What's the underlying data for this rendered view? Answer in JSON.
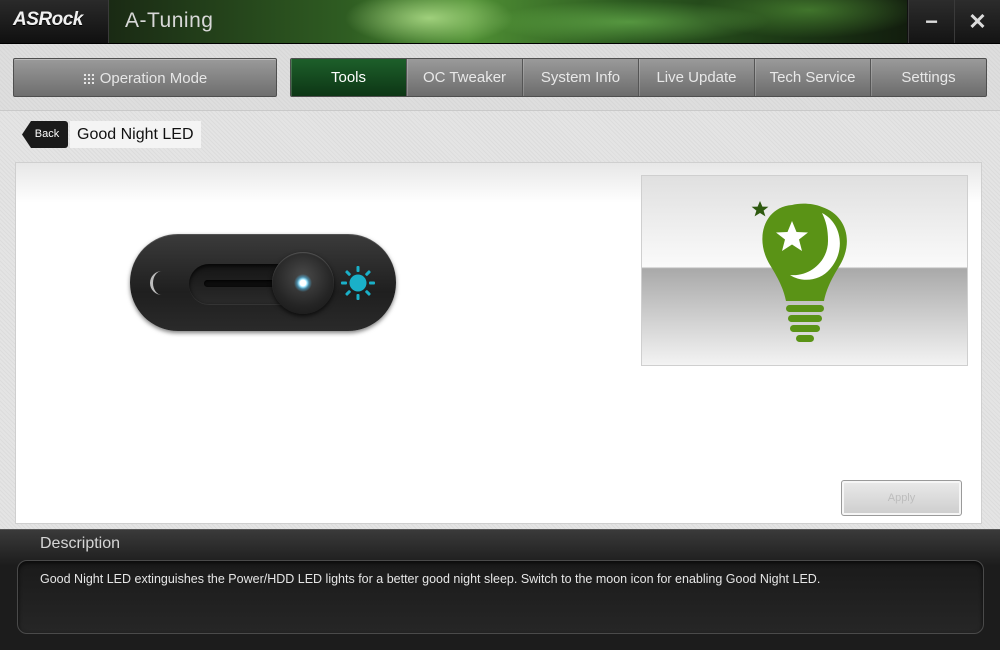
{
  "titlebar": {
    "brand": "ASRock",
    "app_title": "A-Tuning",
    "minimize_label": "−",
    "close_label": "✕"
  },
  "nav": {
    "operation_mode": "Operation Mode",
    "tabs": [
      {
        "label": "Tools",
        "active": true
      },
      {
        "label": "OC Tweaker",
        "active": false
      },
      {
        "label": "System Info",
        "active": false
      },
      {
        "label": "Live Update",
        "active": false
      },
      {
        "label": "Tech Service",
        "active": false
      },
      {
        "label": "Settings",
        "active": false
      }
    ]
  },
  "page": {
    "back_label": "Back",
    "title": "Good Night LED",
    "toggle_state": "sun",
    "apply_label": "Apply"
  },
  "description": {
    "heading": "Description",
    "text": "Good Night LED extinguishes the Power/HDD LED lights for a better good night sleep. Switch to the moon icon for enabling Good Night LED."
  },
  "colors": {
    "active_tab": "#1d5f2a",
    "sun_accent": "#1ab0c8",
    "bulb_green": "#4f8a12"
  }
}
